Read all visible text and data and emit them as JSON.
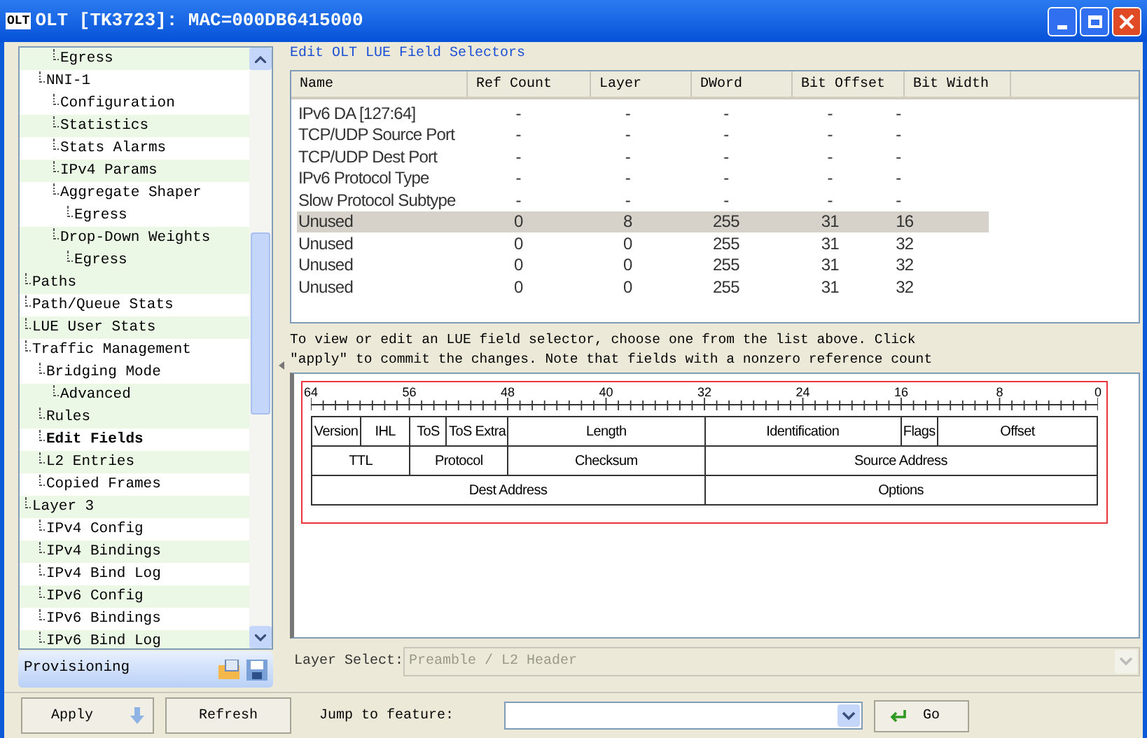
{
  "window": {
    "logo": "OLT",
    "title": "OLT [TK3723]: MAC=000DB6415000"
  },
  "tree": {
    "items": [
      {
        "children": [
          {
            "children": [
              {
                "label": "Egress",
                "selected": false
              }
            ]
          },
          {
            "label": "NNI-1",
            "selected": false,
            "children": [
              {
                "label": "Configuration",
                "selected": false
              },
              {
                "label": "Statistics",
                "selected": false
              },
              {
                "label": "Stats Alarms",
                "selected": false
              },
              {
                "label": "IPv4 Params",
                "selected": false
              },
              {
                "label": "Aggregate Shaper",
                "selected": false,
                "children": [
                  {
                    "label": "Egress",
                    "selected": false
                  }
                ]
              },
              {
                "label": "Drop-Down Weights",
                "selected": false,
                "children": [
                  {
                    "label": "Egress",
                    "selected": false
                  }
                ]
              }
            ]
          }
        ]
      },
      {
        "label": "Paths",
        "selected": false
      },
      {
        "label": "Path/Queue Stats",
        "selected": false
      },
      {
        "label": "LUE User Stats",
        "selected": false
      },
      {
        "label": "Traffic Management",
        "selected": false,
        "children": [
          {
            "label": "Bridging Mode",
            "selected": false,
            "children": [
              {
                "label": "Advanced",
                "selected": false
              }
            ]
          },
          {
            "label": "Rules",
            "selected": false
          },
          {
            "label": "Edit Fields",
            "selected": true
          },
          {
            "label": "L2 Entries",
            "selected": false
          },
          {
            "label": "Copied Frames",
            "selected": false
          }
        ]
      },
      {
        "label": "Layer 3",
        "selected": false,
        "children": [
          {
            "label": "IPv4 Config",
            "selected": false
          },
          {
            "label": "IPv4 Bindings",
            "selected": false
          },
          {
            "label": "IPv4 Bind Log",
            "selected": false
          },
          {
            "label": "IPv6 Config",
            "selected": false
          },
          {
            "label": "IPv6 Bindings",
            "selected": false
          },
          {
            "label": "IPv6 Bind Log",
            "selected": false
          }
        ]
      }
    ]
  },
  "sidebar_footer": {
    "label": "Provisioning"
  },
  "group": {
    "title": "Edit OLT LUE Field Selectors"
  },
  "table": {
    "columns": [
      "Name",
      "Ref Count",
      "Layer",
      "DWord",
      "Bit Offset",
      "Bit Width"
    ],
    "rows": [
      {
        "cells": [
          "IPv6 DA [127:64]",
          "-",
          "-",
          "-",
          "-",
          "-"
        ],
        "selected": false
      },
      {
        "cells": [
          "TCP/UDP Source Port",
          "-",
          "-",
          "-",
          "-",
          "-"
        ],
        "selected": false
      },
      {
        "cells": [
          "TCP/UDP Dest Port",
          "-",
          "-",
          "-",
          "-",
          "-"
        ],
        "selected": false
      },
      {
        "cells": [
          "IPv6 Protocol Type",
          "-",
          "-",
          "-",
          "-",
          "-"
        ],
        "selected": false
      },
      {
        "cells": [
          "Slow Protocol Subtype",
          "-",
          "-",
          "-",
          "-",
          "-"
        ],
        "selected": false
      },
      {
        "cells": [
          "Unused",
          "0",
          "8",
          "255",
          "31",
          "16"
        ],
        "selected": true
      },
      {
        "cells": [
          "Unused",
          "0",
          "0",
          "255",
          "31",
          "32"
        ],
        "selected": false
      },
      {
        "cells": [
          "Unused",
          "0",
          "0",
          "255",
          "31",
          "32"
        ],
        "selected": false
      },
      {
        "cells": [
          "Unused",
          "0",
          "0",
          "255",
          "31",
          "32"
        ],
        "selected": false
      }
    ]
  },
  "description": [
    "To view or edit an LUE field selector, choose one from the list above. Click",
    "\"apply\" to commit the changes. Note that fields with a nonzero reference count"
  ],
  "diagram": {
    "ruler": [
      "64",
      "56",
      "48",
      "40",
      "32",
      "24",
      "16",
      "8",
      "0"
    ],
    "fields": [
      "Version",
      "IHL",
      "ToS",
      "ToS Extra",
      "Length",
      "Identification",
      "Flags",
      "Offset",
      "TTL",
      "Protocol",
      "Checksum",
      "Source Address",
      "Dest Address",
      "Options"
    ]
  },
  "layer_select": {
    "label": "Layer Select:",
    "value": "Preamble / L2 Header",
    "disabled": true
  },
  "bottom": {
    "apply": "Apply",
    "refresh": "Refresh",
    "jump_label": "Jump to feature:",
    "go": "Go"
  }
}
